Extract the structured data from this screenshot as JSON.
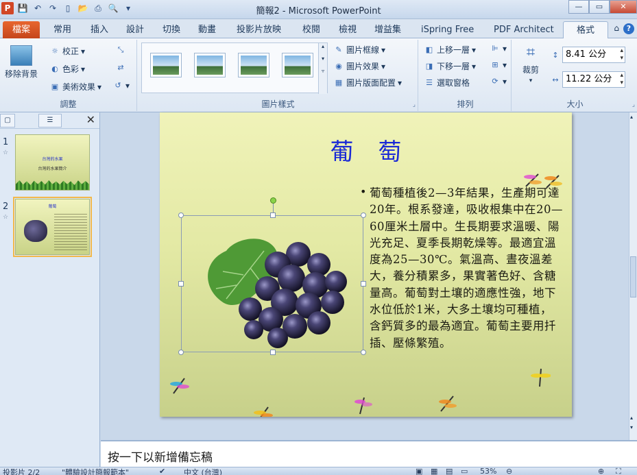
{
  "window": {
    "title": "簡報2 - Microsoft PowerPoint",
    "app_icon": "P"
  },
  "tabs": {
    "file": "檔案",
    "items": [
      "常用",
      "插入",
      "設計",
      "切換",
      "動畫",
      "投影片放映",
      "校閱",
      "檢視",
      "增益集",
      "iSpring Free",
      "PDF Architect",
      "格式"
    ],
    "active": "格式"
  },
  "ribbon": {
    "adjust": {
      "label": "調整",
      "remove_bg": "移除背景",
      "corrections": "校正",
      "color": "色彩",
      "artistic": "美術效果"
    },
    "picture_styles": {
      "label": "圖片樣式",
      "border": "圖片框線",
      "effects": "圖片效果",
      "layout": "圖片版面配置"
    },
    "arrange": {
      "label": "排列",
      "bring_forward": "上移一層",
      "send_backward": "下移一層",
      "selection_pane": "選取窗格"
    },
    "size": {
      "label": "大小",
      "crop": "裁剪",
      "height": "8.41 公分",
      "width": "11.22 公分"
    }
  },
  "slides_panel": {
    "slides": [
      {
        "number": "1",
        "title": "台灣的水果",
        "subtitle": "台灣的水果簡介"
      },
      {
        "number": "2",
        "title": "葡萄"
      }
    ],
    "selected": "2"
  },
  "slide": {
    "title": "葡萄",
    "body": "葡萄種植後2—3年結果，生產期可達20年。根系發達，吸收根集中在20—60厘米土層中。生長期要求溫暖、陽光充足、夏季長期乾燥等。最適宜溫度為25—30℃。氣溫高、晝夜溫差大，養分積累多，果實著色好、含糖量高。葡萄對土壤的適應性強，地下水位低於1米，大多土壤均可種植，含鈣質多的最為適宜。葡萄主要用扦插、壓條繁殖。",
    "bullet": "•"
  },
  "notes": {
    "placeholder": "按一下以新增備忘稿"
  },
  "statusbar": {
    "slide_info": "投影片 2/2",
    "theme": "\"體驗設計簡報範本\"",
    "language": "中文 (台灣)",
    "zoom": "53%"
  }
}
